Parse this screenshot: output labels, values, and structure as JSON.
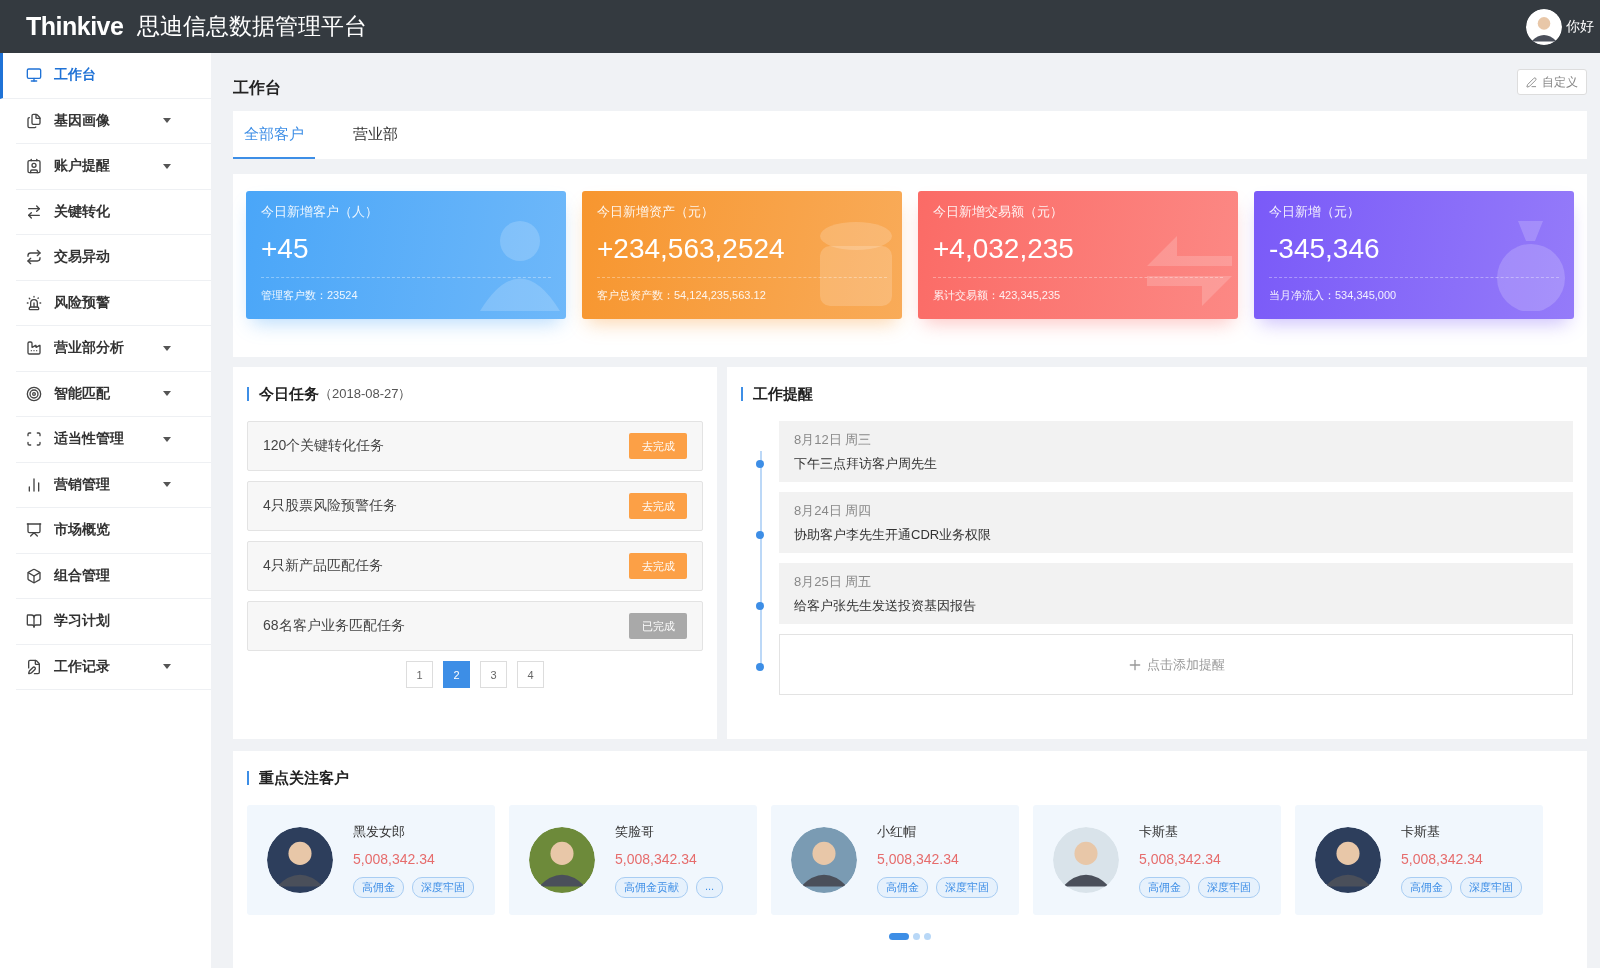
{
  "header": {
    "logo": "Thinkive",
    "title": "思迪信息数据管理平台",
    "greeting": "你好"
  },
  "sidebar": {
    "items": [
      {
        "label": "工作台",
        "expandable": false,
        "selected": true
      },
      {
        "label": "基因画像",
        "expandable": true,
        "selected": false
      },
      {
        "label": "账户提醒",
        "expandable": true,
        "selected": false
      },
      {
        "label": "关键转化",
        "expandable": false,
        "selected": false
      },
      {
        "label": "交易异动",
        "expandable": false,
        "selected": false
      },
      {
        "label": "风险预警",
        "expandable": false,
        "selected": false
      },
      {
        "label": "营业部分析",
        "expandable": true,
        "selected": false
      },
      {
        "label": "智能匹配",
        "expandable": true,
        "selected": false
      },
      {
        "label": "适当性管理",
        "expandable": true,
        "selected": false
      },
      {
        "label": "营销管理",
        "expandable": true,
        "selected": false
      },
      {
        "label": "市场概览",
        "expandable": false,
        "selected": false
      },
      {
        "label": "组合管理",
        "expandable": false,
        "selected": false
      },
      {
        "label": "学习计划",
        "expandable": false,
        "selected": false
      },
      {
        "label": "工作记录",
        "expandable": true,
        "selected": false
      }
    ]
  },
  "page_title": "工作台",
  "customize_button": "自定义",
  "tabs": [
    {
      "label": "全部客户",
      "selected": true
    },
    {
      "label": "营业部",
      "selected": false
    }
  ],
  "stats": [
    {
      "title": "今日新增客户（人）",
      "value": "+45",
      "footer": "管理客户数：23524",
      "color": "#4aa6f8",
      "kind": "people"
    },
    {
      "title": "今日新增资产（元）",
      "value": "+234,563,2524",
      "footer": "客户总资产数：54,124,235,563.12",
      "color": "#f7962f",
      "kind": "coins"
    },
    {
      "title": "今日新增交易额（元）",
      "value": "+4,032,235",
      "footer": "累计交易额：423,345,235",
      "color": "#fb6b66",
      "kind": "exchange"
    },
    {
      "title": "今日新增（元）",
      "value": "-345,346",
      "footer": "当月净流入：534,345,000",
      "color": "#7a5af8",
      "kind": "moneybag"
    }
  ],
  "tasks": {
    "title": "今日任务",
    "date": "（2018-08-27）",
    "items": [
      {
        "label": "120个关键转化任务",
        "button": "去完成",
        "done": false
      },
      {
        "label": "4只股票风险预警任务",
        "button": "去完成",
        "done": false
      },
      {
        "label": "4只新产品匹配任务",
        "button": "去完成",
        "done": false
      },
      {
        "label": "68名客户业务匹配任务",
        "button": "已完成",
        "done": true
      }
    ],
    "pages": [
      {
        "label": "1",
        "selected": false
      },
      {
        "label": "2",
        "selected": true
      },
      {
        "label": "3",
        "selected": false
      },
      {
        "label": "4",
        "selected": false
      }
    ]
  },
  "reminders": {
    "title": "工作提醒",
    "items": [
      {
        "date": "8月12日 周三",
        "text": "下午三点拜访客户周先生"
      },
      {
        "date": "8月24日 周四",
        "text": "协助客户李先生开通CDR业务权限"
      },
      {
        "date": "8月25日 周五",
        "text": "给客户张先生发送投资基因报告"
      }
    ],
    "add_label": "点击添加提醒"
  },
  "customers": {
    "title": "重点关注客户",
    "items": [
      {
        "name": "黑发女郎",
        "amount": "5,008,342.34",
        "tags": [
          "高佣金",
          "深度牢固"
        ]
      },
      {
        "name": "笑脸哥",
        "amount": "5,008,342.34",
        "tags": [
          "高佣金贡献",
          "..."
        ]
      },
      {
        "name": "小红帽",
        "amount": "5,008,342.34",
        "tags": [
          "高佣金",
          "深度牢固"
        ]
      },
      {
        "name": "卡斯基",
        "amount": "5,008,342.34",
        "tags": [
          "高佣金",
          "深度牢固"
        ]
      },
      {
        "name": "卡斯基",
        "amount": "5,008,342.34",
        "tags": [
          "高佣金",
          "深度牢固"
        ]
      }
    ],
    "dots": [
      {
        "selected": true
      },
      {
        "selected": false
      },
      {
        "selected": false
      }
    ]
  }
}
